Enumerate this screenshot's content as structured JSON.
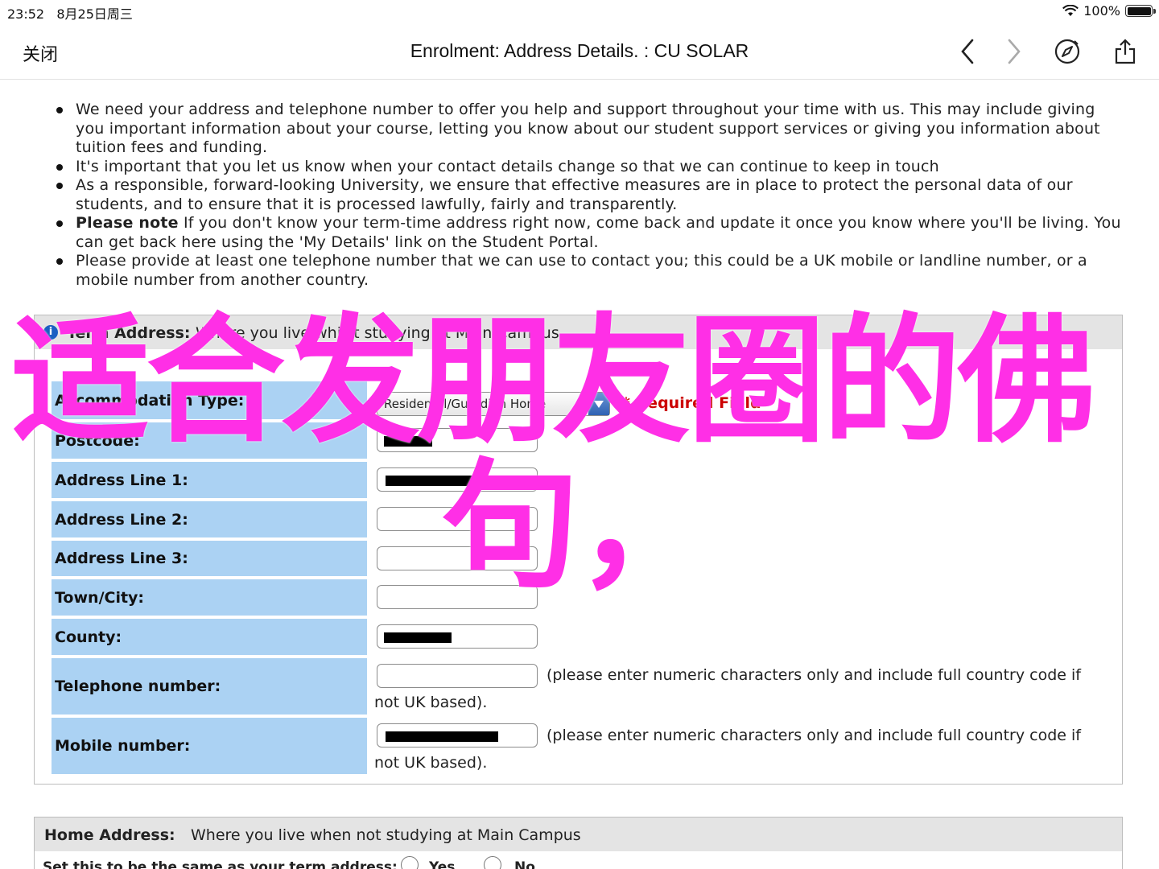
{
  "status": {
    "time": "23:52",
    "date": "8月25日周三",
    "battery": "100%"
  },
  "nav": {
    "close": "关闭",
    "title": "Enrolment: Address Details. : CU SOLAR"
  },
  "notes": [
    "We need your address and telephone number to offer you help and support throughout your time with us. This may include giving you important information about your course, letting you know about our student support services or giving you information about tuition fees and funding.",
    "It's important that you let us know when your contact details change so that we can continue to keep in touch",
    "As a responsible, forward-looking University, we ensure that effective measures are in place to protect the personal data of our students, and to ensure that it is processed lawfully, fairly and transparently.",
    {
      "bold": "Please note",
      "text": " If you don't know your term-time address right now, come back and update it once you know where you'll be living. You can get back here using the 'My Details' link on the Student Portal."
    },
    "Please provide at least one telephone number that we can use to contact you; this could be a UK mobile or landline number, or a mobile number from another country."
  ],
  "term": {
    "label": "Term Address:",
    "desc": "Where you live whilst studying at Main Campus",
    "accommodation_label": "Accommodation Type:",
    "accommodation_value": "Residental/Guardian Home",
    "required": "* Required Field",
    "postcode": "Postcode:",
    "line1": "Address Line 1:",
    "line2": "Address Line 2:",
    "line3": "Address Line 3:",
    "town": "Town/City:",
    "county": "County:",
    "telephone": "Telephone number:",
    "mobile": "Mobile number:",
    "hint_a": "(please enter numeric characters only and include full country code if",
    "hint_b": "not UK based)."
  },
  "home": {
    "label": "Home Address:",
    "desc": "Where you live when not studying at Main Campus",
    "question": "Set this to be the same as your term address:",
    "yes": "Yes",
    "no": "No"
  },
  "overlay": {
    "line1": "适合发朋友圈的佛",
    "line2": "句，"
  },
  "colors": {
    "label_bg": "#abd2f3",
    "header_bg": "#e4e4e4",
    "overlay": "#ff2fe6",
    "required": "#cc0000"
  }
}
